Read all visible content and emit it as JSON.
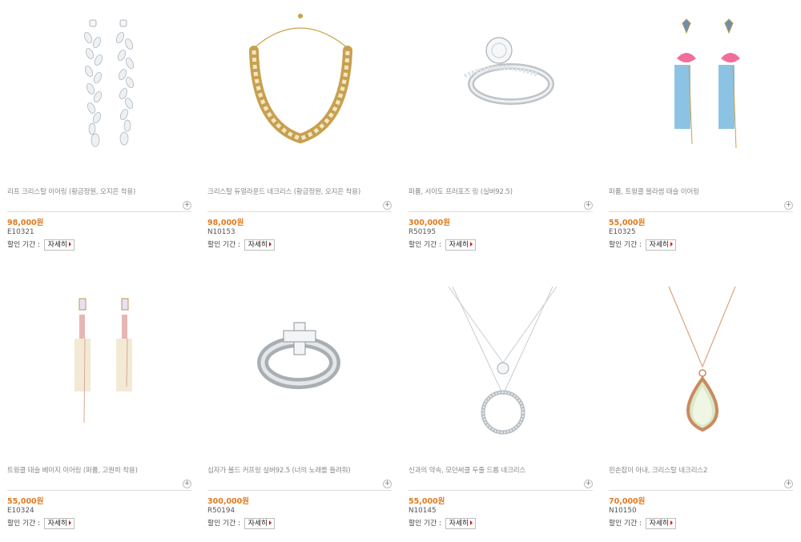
{
  "products": [
    {
      "name": "리프 크리스탈 이어링 (황금정원, 오지은 착용)",
      "price": "98,000원",
      "code": "E10321",
      "icon": "crystal-leaf-earrings"
    },
    {
      "name": "크리스탈 듀얼라운드 네크리스 (황금정원, 오지은 착용)",
      "price": "98,000원",
      "code": "N10153",
      "icon": "gold-crystal-necklace"
    },
    {
      "name": "퍼퓸, 서이도 프러포즈 링 (실버92.5)",
      "price": "300,000원",
      "code": "R50195",
      "icon": "silver-solitaire-ring"
    },
    {
      "name": "퍼퓸, 트윙클 블라썸 태슬 이어링",
      "price": "55,000원",
      "code": "E10325",
      "icon": "pink-blue-tassel-earrings"
    },
    {
      "name": "트윙클 태슬 베이지 이어링 (퍼퓸, 고원희 착용)",
      "price": "55,000원",
      "code": "E10324",
      "icon": "beige-tassel-earrings"
    },
    {
      "name": "십자가 볼드 커프링 실버92.5 (너의 노래를 들려줘)",
      "price": "300,000원",
      "code": "R50194",
      "icon": "silver-cross-ring"
    },
    {
      "name": "신과의 약속, 모던써클 두줄 드롭 네크리스",
      "price": "55,000원",
      "code": "N10145",
      "icon": "silver-circle-necklace"
    },
    {
      "name": "왼손잡이 아내, 크리스탈 네크리스2",
      "price": "70,000원",
      "code": "N10150",
      "icon": "opal-drop-necklace"
    }
  ],
  "labels": {
    "discount_period": "할인 기간 :",
    "detail_button": "자세히",
    "plus_symbol": "+"
  }
}
